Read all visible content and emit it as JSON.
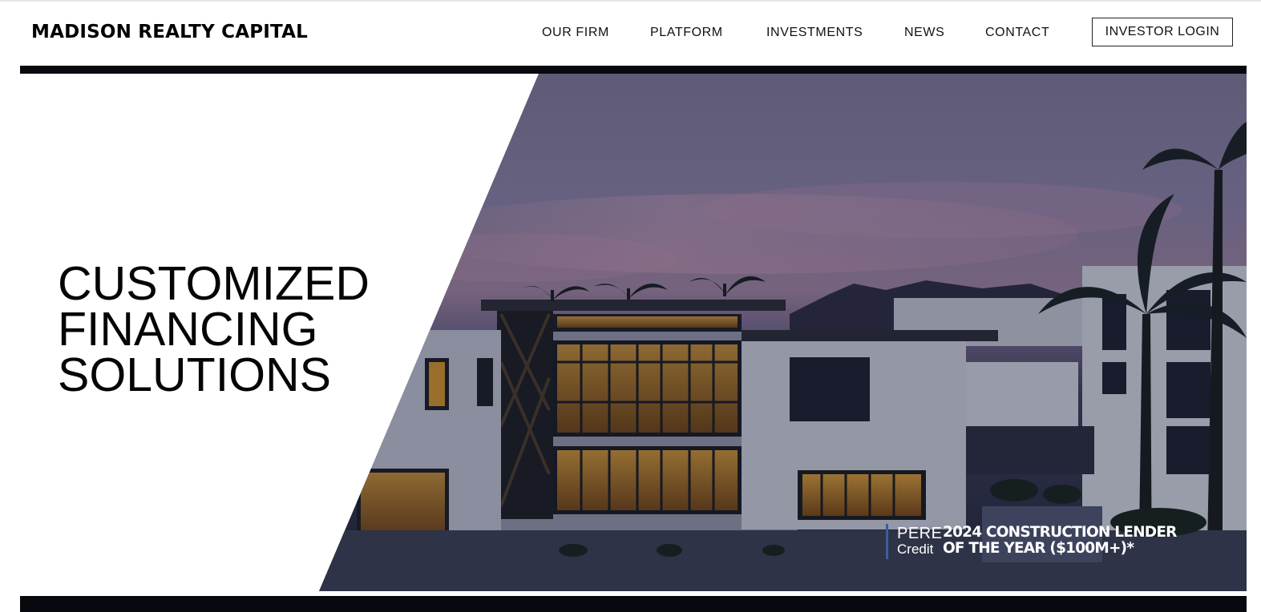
{
  "header": {
    "logo": "MADISON REALTY CAPITAL",
    "nav": [
      "OUR FIRM",
      "PLATFORM",
      "INVESTMENTS",
      "NEWS",
      "CONTACT"
    ],
    "login_label": "INVESTOR LOGIN"
  },
  "hero": {
    "headline": [
      "CUSTOMIZED",
      "FINANCING",
      "SOLUTIONS"
    ],
    "image": "modern-residence-at-dusk",
    "award": {
      "brand_line1": "PERE",
      "brand_line2": "Credit",
      "title_line1": "2024 CONSTRUCTION LENDER",
      "title_line2": "OF THE YEAR ($100M+)*"
    }
  },
  "colors": {
    "bar": "#07090f",
    "text": "#000000",
    "award_accent": "#3a5f9a"
  }
}
